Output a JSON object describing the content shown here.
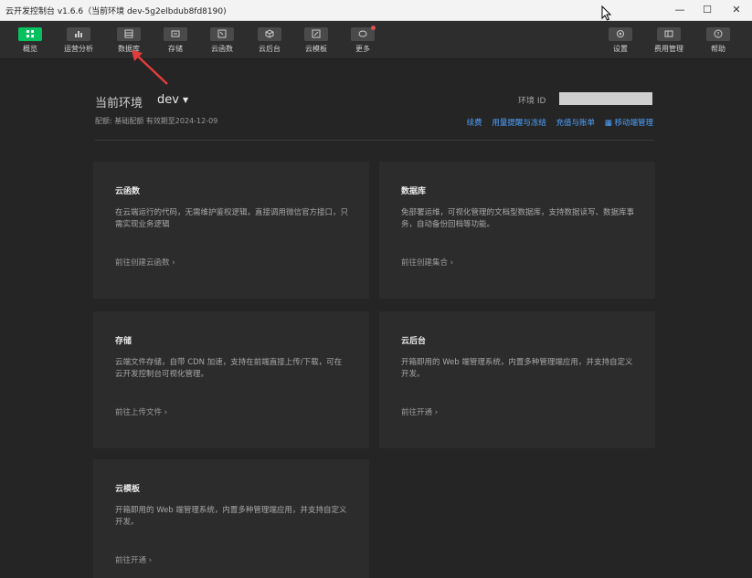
{
  "window": {
    "title": "云开发控制台 v1.6.6（当前环境 dev-5g2elbdub8fd8190)",
    "minimize": "—",
    "maximize": "☐",
    "close": "✕"
  },
  "toolbar": {
    "items": [
      {
        "label": "概览",
        "icon": "overview-icon",
        "active": true
      },
      {
        "label": "运营分析",
        "icon": "bar-chart-icon"
      },
      {
        "label": "数据库",
        "icon": "database-icon"
      },
      {
        "label": "存储",
        "icon": "storage-icon"
      },
      {
        "label": "云函数",
        "icon": "function-icon"
      },
      {
        "label": "云后台",
        "icon": "cube-icon"
      },
      {
        "label": "云模板",
        "icon": "template-icon"
      },
      {
        "label": "更多",
        "icon": "more-icon",
        "badge": true
      }
    ],
    "right_items": [
      {
        "label": "设置",
        "icon": "gear-icon"
      },
      {
        "label": "费用管理",
        "icon": "billing-icon"
      },
      {
        "label": "帮助",
        "icon": "help-icon"
      }
    ]
  },
  "env": {
    "label": "当前环境",
    "value": "dev",
    "plan_text": "配额: 基础配额  有效期至2024-12-09",
    "id_label": "环境 ID"
  },
  "links": [
    "续费",
    "用量提醒与冻结",
    "充值与账单",
    "移动端管理"
  ],
  "cards": [
    {
      "title": "云函数",
      "desc": "在云端运行的代码，无需维护鉴权逻辑，直接调用微信官方接口，只需实现业务逻辑",
      "link": "前往创建云函数 ›"
    },
    {
      "title": "数据库",
      "desc": "免部署运维，可视化管理的文档型数据库，支持数据读写、数据库事务，自动备份回档等功能。",
      "link": "前往创建集合 ›"
    },
    {
      "title": "存储",
      "desc": "云端文件存储，自带 CDN 加速，支持在前端直接上传/下载，可在云开发控制台可视化管理。",
      "link": "前往上传文件 ›"
    },
    {
      "title": "云后台",
      "desc": "开箱即用的 Web 端管理系统，内置多种管理端应用，并支持自定义开发。",
      "link": "前往开通 ›"
    },
    {
      "title": "云模板",
      "desc": "开箱即用的 Web 端管理系统，内置多种管理端应用，并支持自定义开发。",
      "link": "前往开通 ›"
    }
  ],
  "colors": {
    "accent": "#07c160",
    "link": "#4da3ff",
    "annotation": "#e33b3b"
  }
}
